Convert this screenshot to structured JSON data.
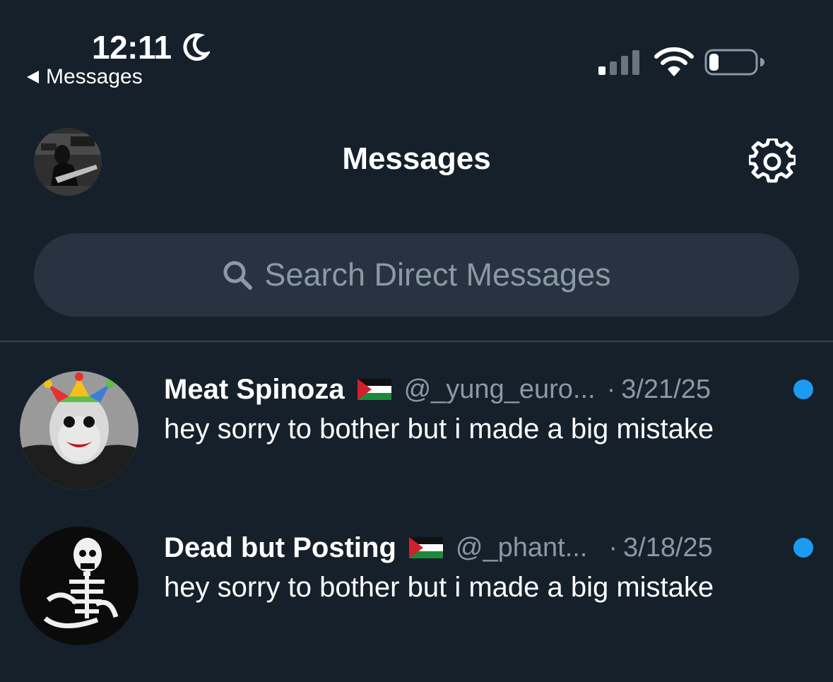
{
  "status_bar": {
    "time": "12:11",
    "back_label": "Messages",
    "icons": [
      "moon-icon",
      "cellular-signal-icon",
      "wifi-icon",
      "battery-icon"
    ]
  },
  "header": {
    "title": "Messages",
    "settings_icon": "gear-icon",
    "avatar": "profile-avatar"
  },
  "search": {
    "placeholder": "Search Direct Messages",
    "icon": "search-icon"
  },
  "colors": {
    "background": "#15202b",
    "search_field": "#273340",
    "secondary_text": "#8b98a5",
    "unread_dot": "#1d9bf0",
    "divider": "#38444d"
  },
  "conversations": [
    {
      "name": "Meat Spinoza",
      "flag": "palestine-flag-icon",
      "handle": "@_yung_euro...",
      "separator": "·",
      "date": "3/21/25",
      "preview": "hey sorry to bother but i made a big mistake",
      "unread": true
    },
    {
      "name": "Dead but Posting",
      "flag": "palestine-flag-icon",
      "handle": "@_phant...",
      "separator": "·",
      "date": "3/18/25",
      "preview": "hey sorry to bother but i made a big mistake",
      "unread": true
    }
  ]
}
